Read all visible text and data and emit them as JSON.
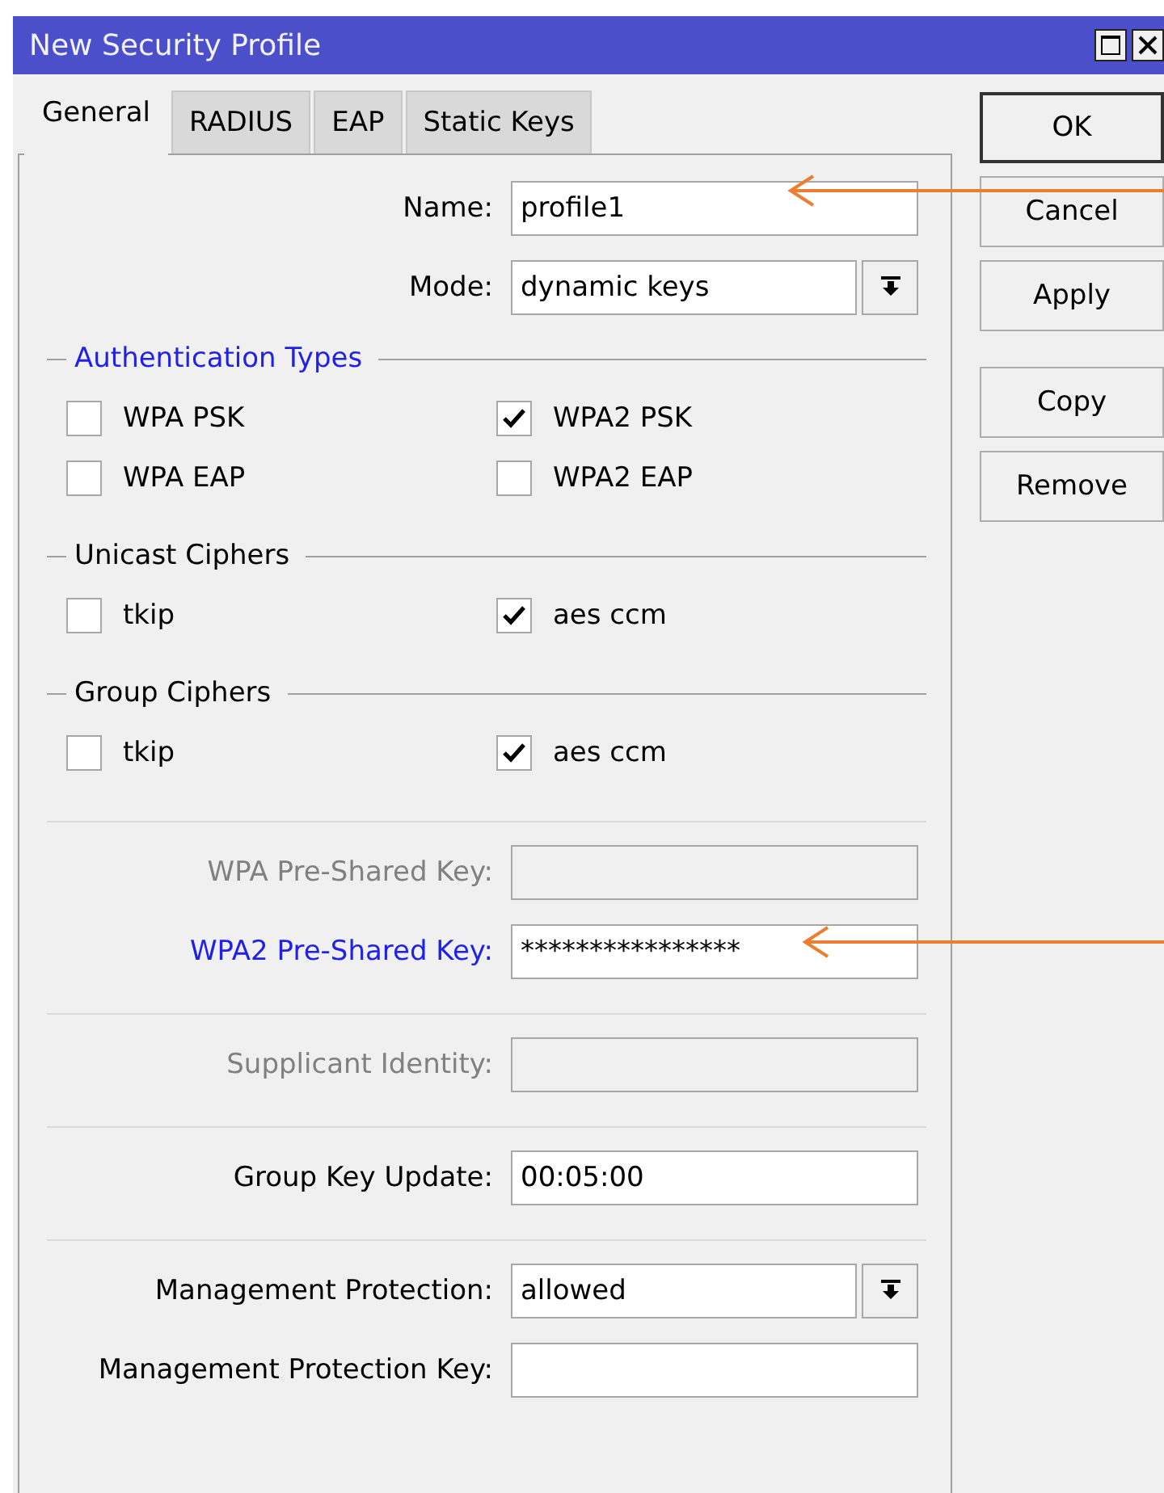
{
  "window": {
    "title": "New Security Profile"
  },
  "tabs": [
    {
      "label": "General",
      "selected": true
    },
    {
      "label": "RADIUS",
      "selected": false
    },
    {
      "label": "EAP",
      "selected": false
    },
    {
      "label": "Static Keys",
      "selected": false
    }
  ],
  "rows": [
    {
      "kind": "text",
      "label": "Name:",
      "value": "profile1",
      "highlighted": false,
      "disabled": false
    },
    {
      "kind": "select",
      "label": "Mode:",
      "value": "dynamic keys",
      "highlighted": false,
      "disabled": false
    },
    {
      "kind": "group",
      "title": "Authentication Types",
      "highlighted": true,
      "items": [
        {
          "label": "WPA PSK",
          "checked": false
        },
        {
          "label": "WPA2 PSK",
          "checked": true
        },
        {
          "label": "WPA EAP",
          "checked": false
        },
        {
          "label": "WPA2 EAP",
          "checked": false
        }
      ]
    },
    {
      "kind": "group",
      "title": "Unicast Ciphers",
      "highlighted": false,
      "items": [
        {
          "label": "tkip",
          "checked": false
        },
        {
          "label": "aes ccm",
          "checked": true
        }
      ]
    },
    {
      "kind": "group",
      "title": "Group Ciphers",
      "highlighted": false,
      "items": [
        {
          "label": "tkip",
          "checked": false
        },
        {
          "label": "aes ccm",
          "checked": true
        }
      ]
    },
    {
      "kind": "separator"
    },
    {
      "kind": "text",
      "label": "WPA Pre-Shared Key:",
      "highlighted": false,
      "disabled": true
    },
    {
      "kind": "text",
      "label": "WPA2 Pre-Shared Key:",
      "value": "****************",
      "highlighted": true,
      "disabled": false
    },
    {
      "kind": "separator"
    },
    {
      "kind": "text",
      "label": "Supplicant Identity:",
      "highlighted": false,
      "disabled": true
    },
    {
      "kind": "separator"
    },
    {
      "kind": "text",
      "label": "Group Key Update:",
      "value": "00:05:00",
      "highlighted": false,
      "disabled": false
    },
    {
      "kind": "separator"
    },
    {
      "kind": "select",
      "label": "Management Protection:",
      "value": "allowed",
      "highlighted": false,
      "disabled": false
    },
    {
      "kind": "text",
      "label": "Management Protection Key:",
      "highlighted": false,
      "disabled": false
    }
  ],
  "button_groups": [
    [
      {
        "label": "OK",
        "default": true
      },
      {
        "label": "Cancel",
        "default": false
      },
      {
        "label": "Apply",
        "default": false
      }
    ],
    [
      {
        "label": "Copy",
        "default": false
      },
      {
        "label": "Remove",
        "default": false
      }
    ]
  ]
}
